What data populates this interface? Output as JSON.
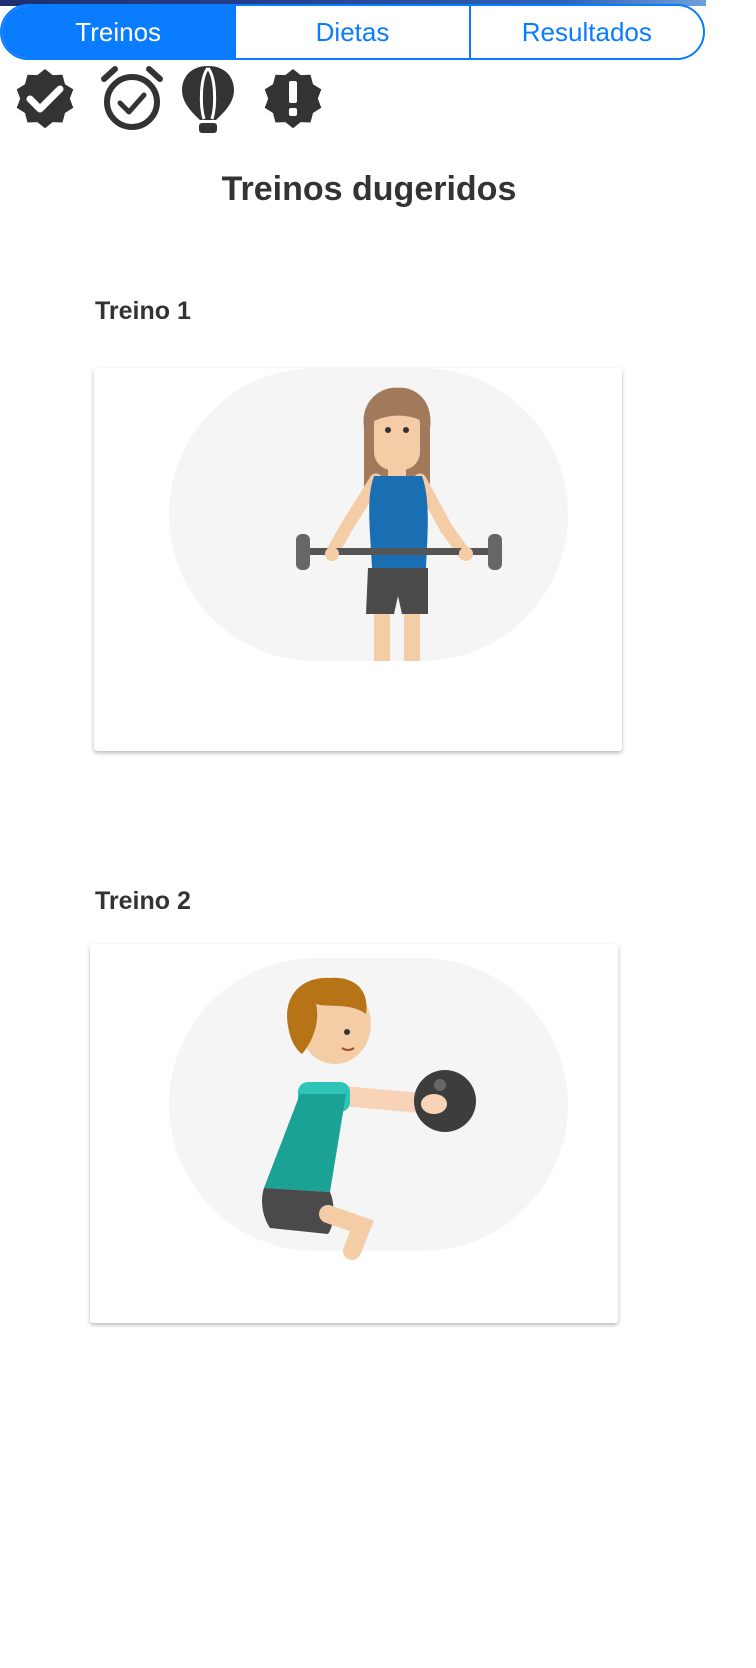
{
  "tabs": [
    {
      "label": "Treinos",
      "active": true
    },
    {
      "label": "Dietas",
      "active": false
    },
    {
      "label": "Resultados",
      "active": false
    }
  ],
  "status_icons": [
    "verified-badge-icon",
    "alarm-check-icon",
    "hot-air-balloon-icon",
    "alert-badge-icon"
  ],
  "main": {
    "title": "Treinos dugeridos",
    "workouts": [
      {
        "label": "Treino 1",
        "illustration": "woman-barbell-illustration"
      },
      {
        "label": "Treino 2",
        "illustration": "man-medicine-ball-squat-illustration"
      }
    ]
  },
  "colors": {
    "accent": "#0a7cff",
    "text": "#333333",
    "icon": "#333333"
  }
}
